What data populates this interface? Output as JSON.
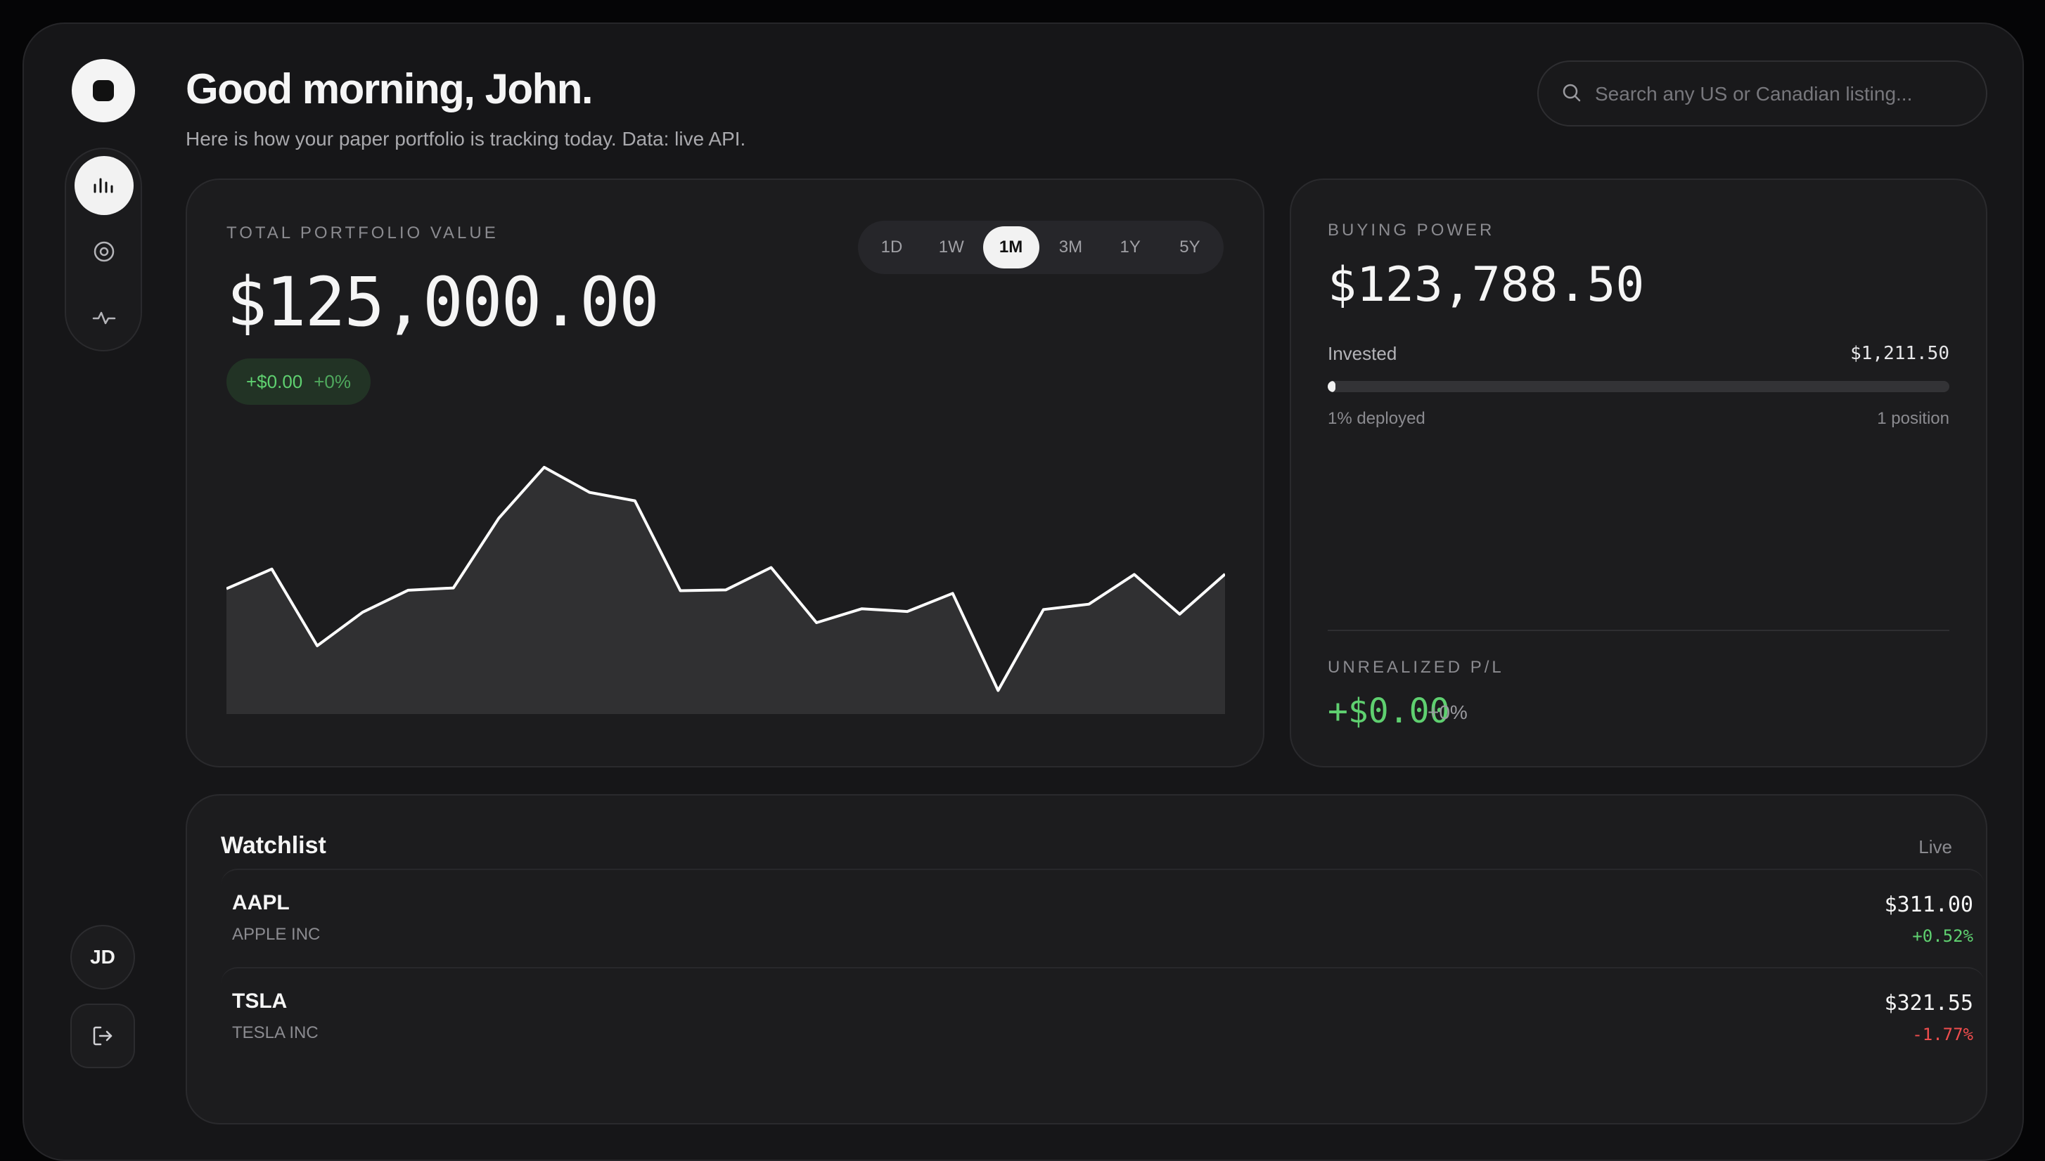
{
  "header": {
    "greeting": "Good morning, John.",
    "subtitle": "Here is how your paper portfolio is tracking today. Data: live API.",
    "search_placeholder": "Search any US or Canadian listing..."
  },
  "sidebar": {
    "nav": [
      {
        "icon": "bar-chart-icon",
        "active": true
      },
      {
        "icon": "target-icon",
        "active": false
      },
      {
        "icon": "activity-icon",
        "active": false
      }
    ],
    "avatar_initials": "JD",
    "logout_icon": "logout-icon"
  },
  "portfolio": {
    "label": "TOTAL PORTFOLIO VALUE",
    "value": "$125,000.00",
    "change": "+$0.00",
    "change_pct": "+0%",
    "ranges": [
      "1D",
      "1W",
      "1M",
      "3M",
      "1Y",
      "5Y"
    ],
    "selected_range": "1M"
  },
  "chart_data": {
    "type": "area",
    "values": [
      62.5,
      67.6,
      47.7,
      56.4,
      62.1,
      62.7,
      80.8,
      94.0,
      87.5,
      85.3,
      62.0,
      62.2,
      68.0,
      53.7,
      57.3,
      56.6,
      61.3,
      36.1,
      57.1,
      58.5,
      66.2,
      55.9,
      66.3
    ],
    "ylim": [
      30,
      100
    ],
    "grid": false,
    "colors": {
      "line": "#ffffff",
      "fill": "#303032"
    }
  },
  "buying_power": {
    "label": "BUYING POWER",
    "value": "$123,788.50",
    "invested_label": "Invested",
    "invested_value": "$1,211.50",
    "deployed_pct": 1,
    "deployed_text": "1% deployed",
    "positions_text": "1 position",
    "upl_label": "UNREALIZED P/L",
    "upl_value": "+$0.00",
    "upl_pct": "+0%"
  },
  "watchlist": {
    "title": "Watchlist",
    "status": "Live",
    "items": [
      {
        "symbol": "AAPL",
        "name": "APPLE INC",
        "price": "$311.00",
        "change": "+0.52%",
        "direction": "up"
      },
      {
        "symbol": "TSLA",
        "name": "TESLA INC",
        "price": "$321.55",
        "change": "-1.77%",
        "direction": "down"
      }
    ]
  },
  "colors": {
    "positive": "#5fd070",
    "negative": "#ef4d4d",
    "background": "#161618"
  }
}
